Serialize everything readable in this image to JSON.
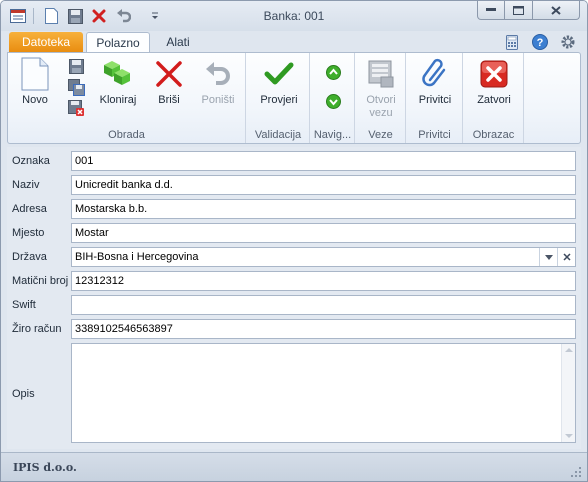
{
  "window": {
    "title": "Banka: 001"
  },
  "quick_access": [
    {
      "name": "app-menu-icon"
    },
    {
      "name": "new-doc-icon"
    },
    {
      "name": "save-icon"
    },
    {
      "name": "delete-icon"
    },
    {
      "name": "undo-icon"
    },
    {
      "name": "customize-qat-icon"
    }
  ],
  "tabs": {
    "file": "Datoteka",
    "home": "Polazno",
    "tools": "Alati"
  },
  "ribbon": {
    "groups": {
      "obrada": "Obrada",
      "validacija": "Validacija",
      "navig": "Navig...",
      "veze": "Veze",
      "privitci": "Privitci",
      "obrazac": "Obrazac"
    },
    "buttons": {
      "novo": "Novo",
      "kloniraj": "Kloniraj",
      "brisi": "Briši",
      "ponisti": "Poništi",
      "provjeri": "Provjeri",
      "otvori_vezu_1": "Otvori",
      "otvori_vezu_2": "vezu",
      "privitci": "Privitci",
      "zatvori": "Zatvori"
    }
  },
  "form": {
    "oznaka": {
      "label": "Oznaka",
      "value": "001"
    },
    "naziv": {
      "label": "Naziv",
      "value": "Unicredit banka d.d."
    },
    "adresa": {
      "label": "Adresa",
      "value": "Mostarska b.b."
    },
    "mjesto": {
      "label": "Mjesto",
      "value": "Mostar"
    },
    "drzava": {
      "label": "Država",
      "value": "BIH-Bosna i Hercegovina"
    },
    "maticni_broj": {
      "label": "Matični broj",
      "value": "12312312"
    },
    "swift": {
      "label": "Swift",
      "value": ""
    },
    "ziro_racun": {
      "label": "Žiro račun",
      "value": "3389102546563897"
    },
    "opis": {
      "label": "Opis",
      "value": ""
    }
  },
  "status": {
    "company": "IPIS d.o.o."
  }
}
